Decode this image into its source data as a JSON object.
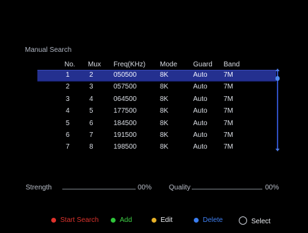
{
  "screen": {
    "title": "Manual Search"
  },
  "table": {
    "headers": {
      "no": "No.",
      "mux": "Mux",
      "freq": "Freq(KHz)",
      "mode": "Mode",
      "guard": "Guard",
      "band": "Band"
    },
    "rows": [
      {
        "no": "1",
        "mux": "2",
        "freq": "050500",
        "mode": "8K",
        "guard": "Auto",
        "band": "7M",
        "selected": true
      },
      {
        "no": "2",
        "mux": "3",
        "freq": "057500",
        "mode": "8K",
        "guard": "Auto",
        "band": "7M"
      },
      {
        "no": "3",
        "mux": "4",
        "freq": "064500",
        "mode": "8K",
        "guard": "Auto",
        "band": "7M"
      },
      {
        "no": "4",
        "mux": "5",
        "freq": "177500",
        "mode": "8K",
        "guard": "Auto",
        "band": "7M"
      },
      {
        "no": "5",
        "mux": "6",
        "freq": "184500",
        "mode": "8K",
        "guard": "Auto",
        "band": "7M"
      },
      {
        "no": "6",
        "mux": "7",
        "freq": "191500",
        "mode": "8K",
        "guard": "Auto",
        "band": "7M"
      },
      {
        "no": "7",
        "mux": "8",
        "freq": "198500",
        "mode": "8K",
        "guard": "Auto",
        "band": "7M"
      }
    ]
  },
  "signal": {
    "strength_label": "Strength",
    "strength_value": "00%",
    "quality_label": "Quality",
    "quality_value": "00%"
  },
  "legend": {
    "start_search": {
      "label": "Start Search",
      "color": "#e0322c",
      "text_color": "#d8322c"
    },
    "add": {
      "label": "Add",
      "color": "#2fc53a",
      "text_color": "#3fcc46"
    },
    "edit": {
      "label": "Edit",
      "color": "#e8b228",
      "text_color": "#e9ebef"
    },
    "delete": {
      "label": "Delete",
      "color": "#3a7df0",
      "text_color": "#3f7ff0"
    },
    "select": {
      "label": "Select",
      "icon": "ok-button-icon"
    }
  },
  "colors": {
    "selected_row": "#24308f",
    "scrollbar": "#2e4dbd"
  }
}
